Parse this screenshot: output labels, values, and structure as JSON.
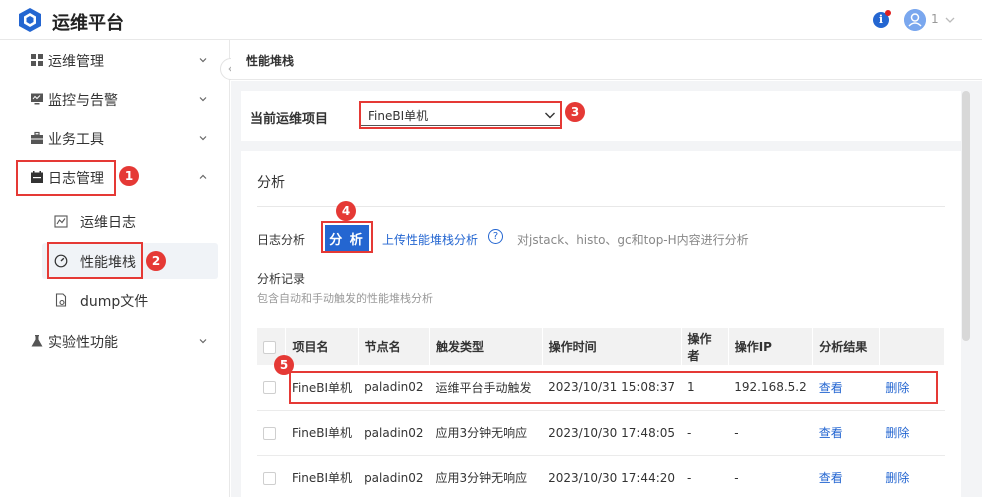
{
  "header": {
    "app_title": "运维平台",
    "user_name": "1",
    "info_glyph": "i"
  },
  "sidebar": {
    "items": [
      {
        "label": "运维管理",
        "icon": "grid-icon"
      },
      {
        "label": "监控与告警",
        "icon": "monitor-icon"
      },
      {
        "label": "业务工具",
        "icon": "toolbox-icon"
      },
      {
        "label": "日志管理",
        "icon": "calendar-icon",
        "expanded": true
      },
      {
        "label": "实验性功能",
        "icon": "flask-icon"
      }
    ],
    "sub_items": [
      {
        "label": "运维日志",
        "icon": "log-icon"
      },
      {
        "label": "性能堆栈",
        "icon": "gauge-icon",
        "active": true
      },
      {
        "label": "dump文件",
        "icon": "file-gear-icon"
      }
    ]
  },
  "breadcrumb": "性能堆栈",
  "project": {
    "label": "当前运维项目",
    "selected": "FineBI单机"
  },
  "analysis": {
    "section_title": "分析",
    "log_label": "日志分析",
    "analyze_button": "分 析",
    "upload_link": "上传性能堆栈分析",
    "help_glyph": "?",
    "help_text": "对jstack、histo、gc和top-H内容进行分析",
    "records_title": "分析记录",
    "records_desc": "包含自动和手动触发的性能堆栈分析"
  },
  "table": {
    "headers": [
      "项目名",
      "节点名",
      "触发类型",
      "操作时间",
      "操作者",
      "操作IP",
      "分析结果"
    ],
    "rows": [
      {
        "project": "FineBI单机",
        "node": "paladin02",
        "trigger": "运维平台手动触发",
        "time": "2023/10/31 15:08:37",
        "operator": "1",
        "ip": "192.168.5.2",
        "view": "查看",
        "delete": "删除"
      },
      {
        "project": "FineBI单机",
        "node": "paladin02",
        "trigger": "应用3分钟无响应",
        "time": "2023/10/30 17:48:05",
        "operator": "-",
        "ip": "-",
        "view": "查看",
        "delete": "删除"
      },
      {
        "project": "FineBI单机",
        "node": "paladin02",
        "trigger": "应用3分钟无响应",
        "time": "2023/10/30 17:44:20",
        "operator": "-",
        "ip": "-",
        "view": "查看",
        "delete": "删除"
      }
    ]
  },
  "callouts": [
    "1",
    "2",
    "3",
    "4",
    "5"
  ],
  "colors": {
    "primary": "#2466d1",
    "callout": "#e53935",
    "background": "#f3f4f6"
  }
}
